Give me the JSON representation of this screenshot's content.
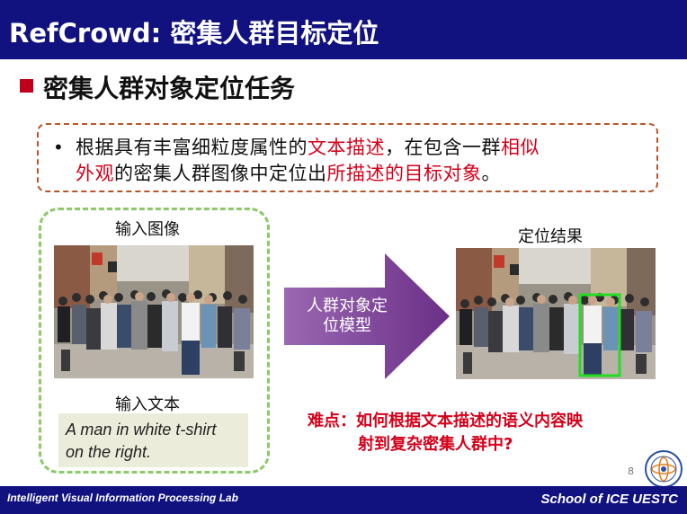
{
  "slide": {
    "title": "RefCrowd: 密集人群目标定位",
    "section_title": "密集人群对象定位任务",
    "task": {
      "bullet": "•",
      "line1_a": "根据具有丰富细粒度属性的",
      "line1_b": "文本描述",
      "line1_c": "，在包含一群",
      "line1_d": "相似",
      "line2_a": "外观",
      "line2_b": "的密集人群图像中定位出",
      "line2_c": "所描述的目标对象",
      "line2_d": "。"
    },
    "input_image_label": "输入图像",
    "input_text_label": "输入文本",
    "query_line1": "A man in white t-shirt",
    "query_line2": "on the right.",
    "model_label_line1": "人群对象定",
    "model_label_line2": "位模型",
    "result_label": "定位结果",
    "difficulty_line1": "难点：如何根据文本描述的语义内容映",
    "difficulty_line2": "射到复杂密集人群中?",
    "page_number": "8",
    "footer_left": "Intelligent Visual Information Processing Lab",
    "footer_right": "School of ICE   UESTC"
  },
  "colors": {
    "brand_blue": "#11117f",
    "accent_red": "#d4001a",
    "arrow_purple": "#7d3f98",
    "box_dashed_brown": "#b8552a",
    "box_dashed_green": "#8dc86b",
    "highlight_green": "#22dd22"
  },
  "icons": {
    "section_marker": "red-square-icon",
    "university_logo": "uestc-logo-icon"
  }
}
